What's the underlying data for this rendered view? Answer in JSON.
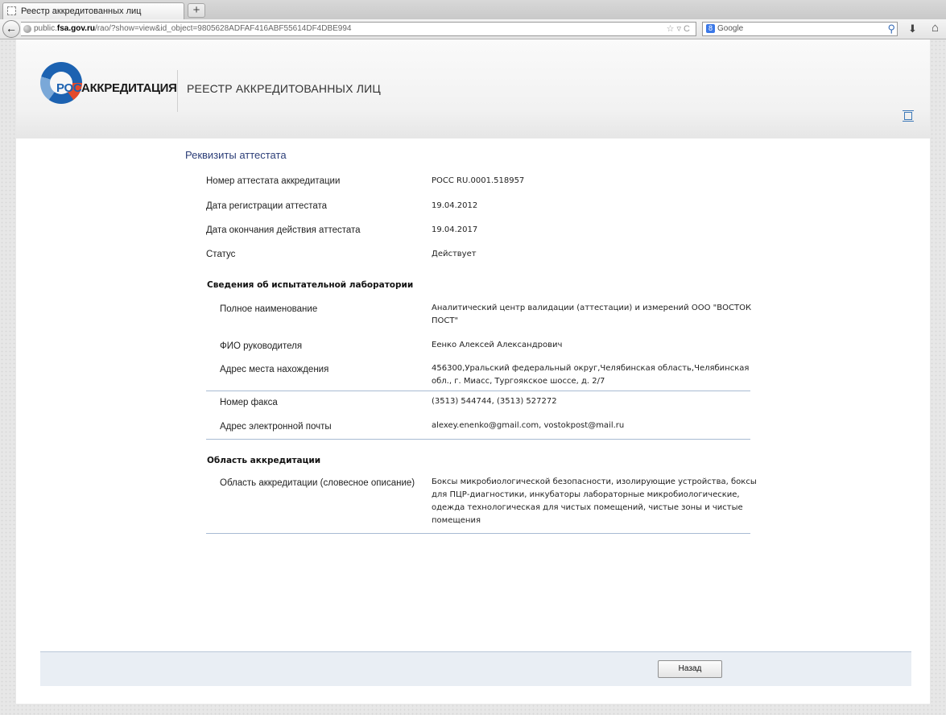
{
  "browser": {
    "tab_title": "Реестр аккредитованных лиц",
    "new_tab_label": "+",
    "url_prefix": "public.",
    "url_host": "fsa.gov.ru",
    "url_path": "/rao/?show=view&id_object=9805628ADFAF416ABF55614DF4DBE994",
    "search_engine_label": "Google",
    "search_engine_badge": "8"
  },
  "header": {
    "logo_ros": "РОС",
    "logo_rest": "АККРЕДИТАЦИЯ",
    "site_title": "РЕЕСТР АККРЕДИТОВАННЫХ ЛИЦ"
  },
  "main": {
    "section_title": "Реквизиты аттестата",
    "certificate": [
      {
        "label": "Номер аттестата аккредитации",
        "value": "РОСС RU.0001.518957"
      },
      {
        "label": "Дата регистрации аттестата",
        "value": "19.04.2012"
      },
      {
        "label": "Дата окончания действия аттестата",
        "value": "19.04.2017"
      },
      {
        "label": "Статус",
        "value": "Действует"
      }
    ],
    "lab_heading": "Сведения об испытательной лаборатории",
    "lab": [
      {
        "label": "Полное наименование",
        "value": "Аналитический центр валидации (аттестации) и измерений ООО \"ВОСТОК ПОСТ\""
      },
      {
        "label": "ФИО руководителя",
        "value": "Еенко Алексей Александрович"
      },
      {
        "label": "Адрес места нахождения",
        "value": "456300,Уральский федеральный округ,Челябинская область,Челябинская обл., г. Миасс, Тургоякское шоссе, д. 2/7"
      },
      {
        "label": "Номер факса",
        "value": "(3513) 544744, (3513) 527272"
      },
      {
        "label": "Адрес электронной почты",
        "value": "alexey.enenko@gmail.com, vostokpost@mail.ru"
      }
    ],
    "scope_heading": "Область аккредитации",
    "scope": {
      "label": "Область аккредитации (словесное описание)",
      "value": "Боксы микробиологической безопасности, изолирующие устройства, боксы для ПЦР-диагностики, инкубаторы лабораторные микробиологические, одежда технологическая для чистых помещений, чистые зоны и чистые помещения"
    }
  },
  "footer": {
    "back_button": "Назад"
  }
}
